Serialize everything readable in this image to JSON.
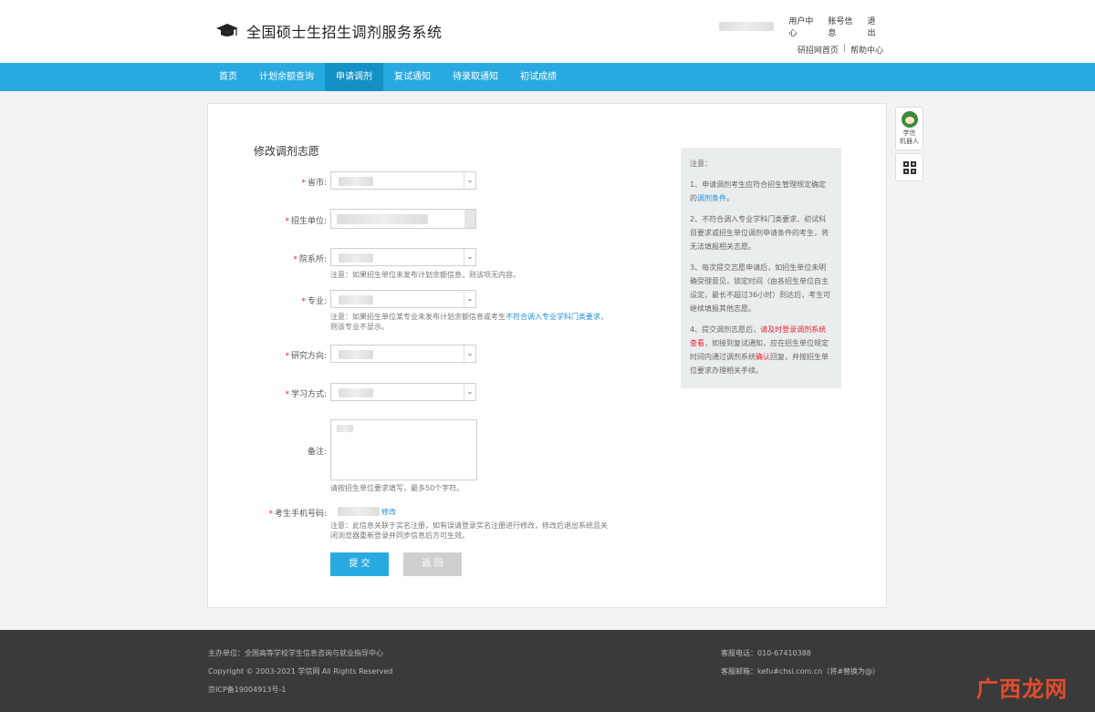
{
  "header": {
    "title": "全国硕士生招生调剂服务系统",
    "links_row1": [
      "用户中心",
      "账号信息",
      "退出"
    ],
    "links_row2": [
      "研招网首页",
      "帮助中心"
    ],
    "row2_separator": "|"
  },
  "nav": {
    "items": [
      {
        "label": "首页",
        "active": false
      },
      {
        "label": "计划余额查询",
        "active": false
      },
      {
        "label": "申请调剂",
        "active": true
      },
      {
        "label": "复试通知",
        "active": false
      },
      {
        "label": "待录取通知",
        "active": false
      },
      {
        "label": "初试成绩",
        "active": false
      }
    ]
  },
  "form": {
    "title": "修改调剂志愿",
    "labels": {
      "province": "省市:",
      "unit": "招生单位:",
      "department": "院系所:",
      "major": "专业:",
      "direction": "研究方向:",
      "study_mode": "学习方式:",
      "remark": "备注:",
      "phone": "考生手机号码:"
    },
    "required_mark": "*",
    "hint_department": "注意：如果招生单位未发布计划余额信息，则该项无内容。",
    "hint_major_prefix": "注意：如果招生单位某专业未发布计划余额信息或考生",
    "hint_major_link": "不符合调入专业学科门类要求",
    "hint_major_suffix": "，则该专业不显示。",
    "hint_remark": "请按招生单位要求填写，最多50个字符。",
    "phone_edit": "修改",
    "hint_phone": "注意：此信息关联于实名注册，如有误请登录实名注册进行修改，修改后退出系统且关闭浏览器重新登录并同步信息后方可生效。",
    "submit": "提 交",
    "back": "返 回"
  },
  "notice": {
    "title": "注意：",
    "p1_prefix": "1、申请调剂考生应符合招生管理规定确定的",
    "p1_link": "调剂条件",
    "p1_suffix": "。",
    "p2": "2、不符合调入专业学科门类要求、初试科目要求或招生单位调剂申请条件的考生，将无法填报相关志愿。",
    "p3": "3、每次提交志愿申请后，如招生单位未明确受理意见，锁定时间（由各招生单位自主设定，最长不超过36小时）到达后，考生可继续填报其他志愿。",
    "p4_prefix": "4、提交调剂志愿后，",
    "p4_red": "请及时登录调剂系统查看",
    "p4_mid": "，如接到复试通知，应在招生单位规定时间内通过调剂系统",
    "p4_red2": "确认",
    "p4_suffix": "回复，并按招生单位要求办理相关手续。"
  },
  "side": {
    "robot_label_1": "学信",
    "robot_label_2": "机器人"
  },
  "footer": {
    "host": "主办单位：全国高等学校学生信息咨询与就业指导中心",
    "copyright": "Copyright © 2003-2021 学信网 All Rights Reserved",
    "icp": "京ICP备19004913号-1",
    "phone": "客服电话：010-67410388",
    "email": "客服邮箱：kefu#chsi.com.cn（将#替换为@）"
  },
  "watermark": "广西龙网",
  "colors": {
    "nav": "#28aae1",
    "nav_active": "#1390c6",
    "footer": "#3a3a3a",
    "required": "#e22233"
  }
}
